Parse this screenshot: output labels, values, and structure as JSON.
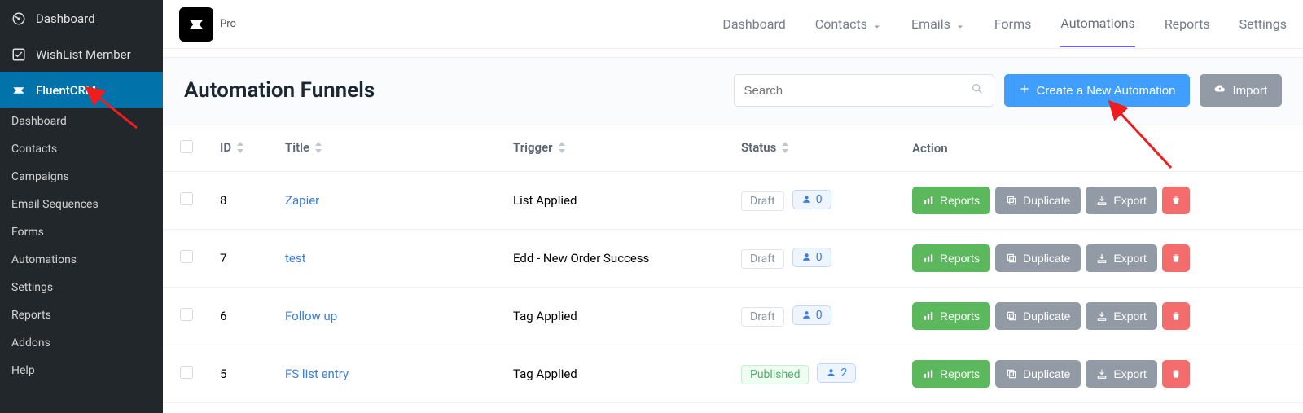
{
  "wp_sidebar": {
    "dashboard": "Dashboard",
    "wishlist": "WishList Member",
    "fluentcrm": "FluentCRM",
    "submenu": [
      "Dashboard",
      "Contacts",
      "Campaigns",
      "Email Sequences",
      "Forms",
      "Automations",
      "Settings",
      "Reports",
      "Addons",
      "Help"
    ]
  },
  "brand": {
    "pro": "Pro"
  },
  "topnav": {
    "dashboard": "Dashboard",
    "contacts": "Contacts",
    "emails": "Emails",
    "forms": "Forms",
    "automations": "Automations",
    "reports": "Reports",
    "settings": "Settings"
  },
  "page": {
    "title": "Automation Funnels"
  },
  "search": {
    "placeholder": "Search"
  },
  "buttons": {
    "create": "Create a New Automation",
    "import": "Import",
    "reports": "Reports",
    "duplicate": "Duplicate",
    "export": "Export"
  },
  "cols": {
    "id": "ID",
    "title": "Title",
    "trigger": "Trigger",
    "status": "Status",
    "action": "Action"
  },
  "rows": [
    {
      "id": "8",
      "title": "Zapier",
      "trigger": "List Applied",
      "status": "Draft",
      "published": false,
      "count": "0"
    },
    {
      "id": "7",
      "title": "test",
      "trigger": "Edd - New Order Success",
      "status": "Draft",
      "published": false,
      "count": "0"
    },
    {
      "id": "6",
      "title": "Follow up",
      "trigger": "Tag Applied",
      "status": "Draft",
      "published": false,
      "count": "0"
    },
    {
      "id": "5",
      "title": "FS list entry",
      "trigger": "Tag Applied",
      "status": "Published",
      "published": true,
      "count": "2"
    }
  ]
}
